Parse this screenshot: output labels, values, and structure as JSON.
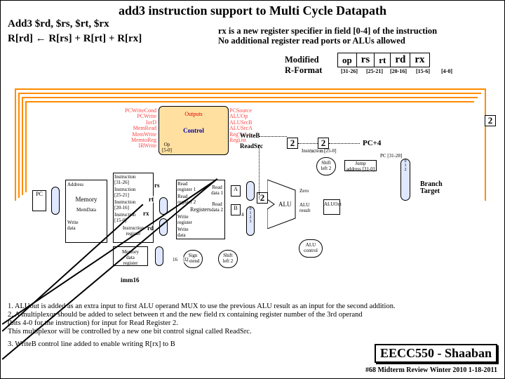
{
  "title": "add3  instruction support to Multi Cycle Datapath",
  "instruction": "Add3 $rd, $rs, $rt, $rx",
  "equation": "R[rd]  ←   R[rs] + R[rt] + R[rx]",
  "rx_note_l1": "rx is a new register specifier in field [0-4] of the instruction",
  "rx_note_l2": "No additional register read ports or ALUs allowed",
  "mod_fmt": "Modified\nR-Format",
  "format_fields": [
    "op",
    "rs",
    "rt",
    "rd",
    "rx"
  ],
  "format_bits": [
    "[31-26]",
    "[25-21]",
    "[20-16]",
    "[15-6]",
    "[4-0]"
  ],
  "diagram_labels": {
    "writeb": "WriteB",
    "readsrc": "ReadSrc",
    "pc4": "PC+4",
    "branch_target": "Branch\nTarget",
    "rs": "rs",
    "rt": "rt",
    "rx": "rx",
    "rd": "rd",
    "imm16": "imm16",
    "two": "2",
    "control_signals": [
      "PCWriteCond",
      "PCWrite",
      "IorD",
      "MemRead",
      "MemWrite",
      "MemtoReg",
      "IRWrite"
    ],
    "control_r": [
      "PCSource",
      "ALUOp",
      "ALUSrcB",
      "ALUSrcA",
      "RegWrite",
      "RegDst"
    ],
    "op": "Op\n[5-0]",
    "control": "Control",
    "outputs": "Outputs"
  },
  "notes": [
    "1. ALUout is added as an extra input to first ALU operand MUX to use the previous ALU result as an input for the second addition.",
    "2. A multiplexor should be added to select between  rt and the new field rx containing register number of the 3rd operand",
    "   (bits 4-0 for the instruction) for input for Read Register 2.",
    "   This multiplexor will be controlled by a new one bit control signal called ReadSrc.",
    "3. WriteB control line added to enable writing R[rx] to B"
  ],
  "footer": {
    "course": "EECC550 - Shaaban",
    "ref": "#68  Midterm Review  Winter 2010  1-18-2011"
  }
}
